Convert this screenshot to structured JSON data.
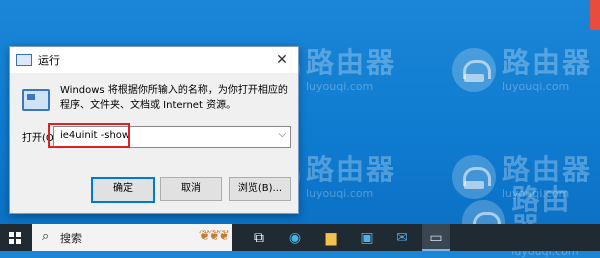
{
  "desktop": {
    "watermark_brand": "路由器",
    "watermark_domain": "luyouqi.com"
  },
  "dialog": {
    "title": "运行",
    "description": "Windows 将根据你所输入的名称，为你打开相应的程序、文件夹、文档或 Internet 资源。",
    "open_label": "打开(O):",
    "command_value": "ie4uinit -show",
    "ok_label": "确定",
    "cancel_label": "取消",
    "browse_label": "浏览(B)..."
  },
  "taskbar": {
    "search_placeholder": "搜索",
    "icons": [
      "task-view-icon",
      "edge-icon",
      "explorer-icon",
      "store-icon",
      "mail-icon",
      "run-app-icon"
    ]
  }
}
